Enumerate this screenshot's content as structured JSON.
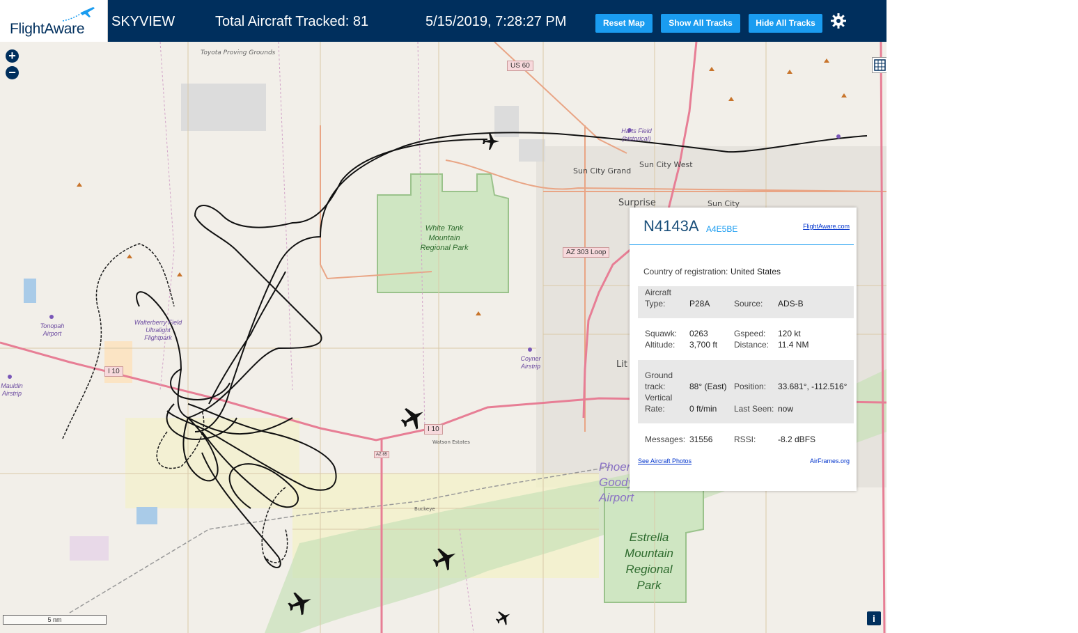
{
  "header": {
    "logo": "FlightAware",
    "app_name": "SKYVIEW",
    "aircraft_tracked": "Total Aircraft Tracked: 81",
    "datetime": "5/15/2019, 7:28:27 PM",
    "buttons": {
      "reset_map": "Reset Map",
      "show_all_tracks": "Show All Tracks",
      "hide_all_tracks": "Hide All Tracks"
    }
  },
  "map": {
    "zoom_in": "+",
    "zoom_out": "−",
    "scale": "5 nm",
    "info": "i",
    "labels": {
      "toyota": "Toyota Proving Grounds",
      "white_tank": "White Tank Mountain Regional Park",
      "estrella": "Estrella Mountain Regional Park",
      "surprise": "Surprise",
      "sun_city": "Sun City",
      "sun_city_west": "Sun City West",
      "sun_city_grand": "Sun City Grand",
      "buckeye": "Buckeye",
      "watson": "Watson Estates",
      "tonopah": "Tonopah Airport",
      "walterberry": "Walterberry Field Ultralight Flightpark",
      "mauldin": "Mauldin Airstrip",
      "coyner": "Coyner Airstrip",
      "harts": "Harts Field (historical)",
      "phoenix_goodyear": "Phoenix Goodyear Airport",
      "lit": "Lit",
      "us60": "US 60",
      "i10a": "I 10",
      "i10b": "I 10",
      "az303": "AZ 303 Loop",
      "az85": "AZ 85"
    }
  },
  "popup": {
    "registration": "N4143A",
    "hex": "A4E5BE",
    "link": "FlightAware.com",
    "country_label": "Country of registration:",
    "country": "United States",
    "aircraft_type_label1": "Aircraft",
    "aircraft_type_label2": "Type:",
    "aircraft_type": "P28A",
    "source_label": "Source:",
    "source": "ADS-B",
    "squawk_label": "Squawk:",
    "squawk": "0263",
    "gspeed_label": "Gspeed:",
    "gspeed": "120 kt",
    "altitude_label": "Altitude:",
    "altitude": "3,700 ft",
    "distance_label": "Distance:",
    "distance": "11.4 NM",
    "ground_track_label1": "Ground",
    "ground_track_label2": "track:",
    "ground_track": "88° (East)",
    "position_label": "Position:",
    "position": "33.681°, -112.516°",
    "vertical_rate_label1": "Vertical",
    "vertical_rate_label2": "Rate:",
    "vertical_rate": "0 ft/min",
    "last_seen_label": "Last Seen:",
    "last_seen": "now",
    "messages_label": "Messages:",
    "messages": "31556",
    "rssi_label": "RSSI:",
    "rssi": "-8.2 dBFS",
    "photos_link": "See Aircraft Photos",
    "airframes_link": "AirFrames.org"
  }
}
